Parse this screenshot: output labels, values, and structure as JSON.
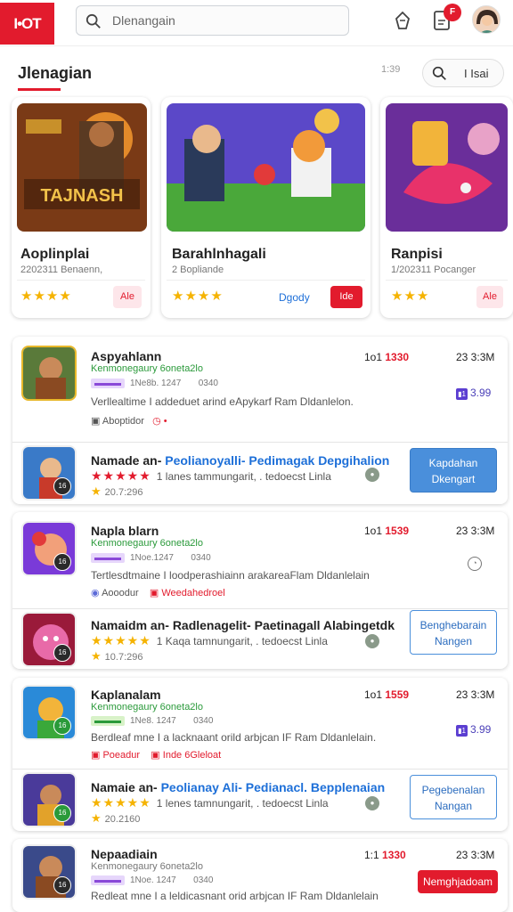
{
  "header": {
    "logo": "I•OT",
    "search_placeholder": "Dlenangain",
    "notification_count": "F",
    "icons": [
      "search-icon",
      "bell-icon",
      "document-icon",
      "avatar"
    ]
  },
  "section": {
    "title": "Jlenagian",
    "count": "1:39",
    "filter_label": "I Isai"
  },
  "featured": [
    {
      "title": "Aoplinplai",
      "subtitle": "2202311 Benaenn,",
      "stars": "★★★★",
      "button": "Ale",
      "art": "TAJNASH"
    },
    {
      "title": "Barahlnhagali",
      "subtitle": "2 Bopliande",
      "stars": "★★★★",
      "link": "Dgody",
      "button": "Ide"
    },
    {
      "title": "Ranpisi",
      "subtitle": "1/202311 Pocanger",
      "stars": "★★★",
      "button": "Ale"
    }
  ],
  "groups": [
    {
      "top": {
        "name": "Aspyahlann",
        "sub": "Kenmonegaury 6oneta2lo",
        "tag_chip": "▬▬▬",
        "tag": "1Ne8b. 1247",
        "tag2": "0340",
        "desc": "Verllealtime I addeduet arind eApykarf Ram Dldanlelon.",
        "action1": "Aboptidor",
        "action1_icon": "▣",
        "action2": "•",
        "num_pre": "1o1",
        "num": "1330",
        "size": "23 3:3M",
        "price": "3.99",
        "price_chip": "▮1"
      },
      "bottom": {
        "name": "Namade an-",
        "name_hl": "Peolianoyalli- Pedimagak Depgihalion",
        "stars": "★★★★★",
        "rating_text": "1 lanes tammungarit, . tedoecst Linla",
        "count": "20.7:296",
        "level": "16",
        "button": "Kapdahan\nDkengart"
      }
    },
    {
      "top": {
        "name": "Napla blarn",
        "sub": "Kenmonegaury 6oneta2lo",
        "tag_chip": "▬▬▬",
        "tag": "1Noe.1247",
        "tag2": "0340",
        "desc": "Tertlesdtmaine I loodperashiainn arakareaFlam Dldanlelain",
        "action1": "Aooodur",
        "action1_icon": "◉",
        "action2": "Weedahedroel",
        "num_pre": "1o1",
        "num": "1539",
        "size": "23 3:3M",
        "price": "",
        "level": "16"
      },
      "bottom": {
        "name": "Namaidm an-",
        "name_hl": "Radlenagelit- Paetinagall Alabingetdk",
        "stars": "★★★★★",
        "rating_text": "1 Kaqa tamnungarit, . tedoecst Linla",
        "count": "10.7:296",
        "level": "16",
        "button": "Benghebarain\nNangen"
      }
    },
    {
      "top": {
        "name": "Kaplanalam",
        "sub": "Kenmonegaury 6oneta2lo",
        "tag_chip": "▬▬▬",
        "tag": "1Ne8. 1247",
        "tag2": "0340",
        "desc": "Berdleaf mne I a lacknaant orild arbjcan IF Ram Dldanlelain.",
        "action1": "Poeadur",
        "action1_icon": "▣",
        "action2": "Inde 6Gleloat",
        "num_pre": "1o1",
        "num": "1559",
        "size": "23 3:3M",
        "price": "3.99",
        "price_chip": "▮1",
        "level": "16"
      },
      "bottom": {
        "name": "Namaie an-",
        "name_hl": "Peolianay Ali- Pedianacl. Bepplenaian",
        "stars": "★★★★★",
        "rating_text": "1 lenes tamnungarit, . tedoecst Linla",
        "count": "20.2160",
        "level": "16",
        "button": "Pegebenalan\nNangan"
      }
    },
    {
      "top": {
        "name": "Nepaadiain",
        "sub": "Kenmonegaury 6oneta2lo",
        "tag_chip": "▬▬▬",
        "tag": "1Noe. 1247",
        "tag2": "0340",
        "desc": "Redleat mne I a leldicasnant orid arbjcan IF Ram Dldanlelain",
        "num_pre": "1:1",
        "num": "1330",
        "size": "23 3:3M",
        "button": "Nemghjadoam",
        "level": "16"
      }
    }
  ],
  "colors": {
    "brand": "#e21b2d",
    "accent_blue": "#4a8fdb",
    "star": "#f5b301",
    "green": "#2b9a3b"
  }
}
